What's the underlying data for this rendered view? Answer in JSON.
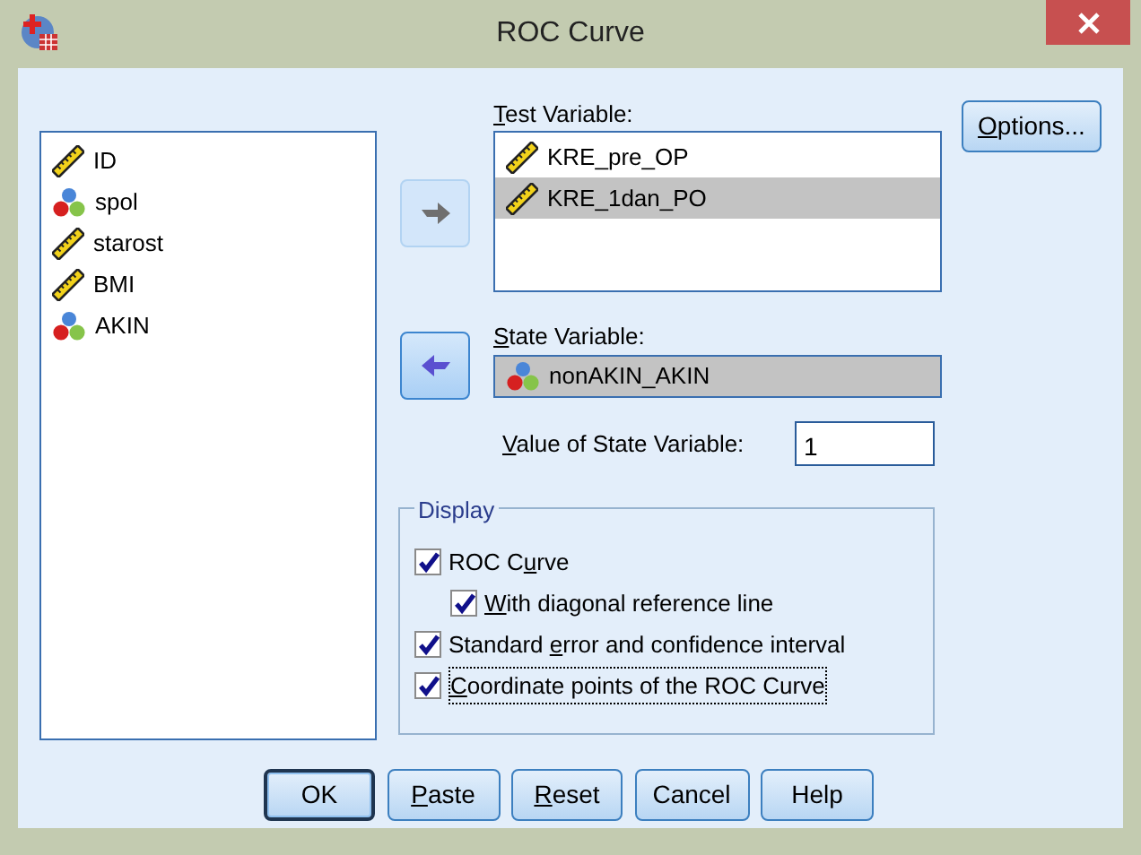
{
  "window": {
    "title": "ROC Curve"
  },
  "source_list": {
    "items": [
      {
        "kind": "scale",
        "label": "ID",
        "selected": false
      },
      {
        "kind": "nominal",
        "label": "spol",
        "selected": false
      },
      {
        "kind": "scale",
        "label": "starost",
        "selected": false
      },
      {
        "kind": "scale",
        "label": "BMI",
        "selected": false
      },
      {
        "kind": "nominal",
        "label": "AKIN",
        "selected": false
      }
    ]
  },
  "move_buttons": [
    {
      "kind": "right",
      "disabled": true
    },
    {
      "kind": "left",
      "disabled": false
    }
  ],
  "test_variable": {
    "label": {
      "key": "T",
      "post": "est Variable:"
    },
    "items": [
      {
        "kind": "scale",
        "label": "KRE_pre_OP",
        "selected": false
      },
      {
        "kind": "scale",
        "label": "KRE_1dan_PO",
        "selected": true
      }
    ]
  },
  "state_variable": {
    "label": {
      "key": "S",
      "post": "tate Variable:"
    },
    "items": [
      {
        "kind": "nominal",
        "label": "nonAKIN_AKIN",
        "selected": true
      }
    ]
  },
  "state_value": {
    "label": {
      "key": "V",
      "post": "alue of State Variable:"
    },
    "value": "1"
  },
  "options_button": {
    "label": {
      "key": "O",
      "post": "ptions..."
    }
  },
  "display": {
    "title": "Display",
    "options": [
      {
        "label": {
          "pre": "ROC C",
          "key": "u",
          "post": "rve"
        },
        "checked": true,
        "focused": false,
        "children": [
          {
            "label": {
              "key": "W",
              "post": "ith diagonal reference line"
            },
            "checked": true,
            "focused": false
          }
        ]
      },
      {
        "label": {
          "pre": "Standard ",
          "key": "e",
          "post": "rror and confidence interval"
        },
        "checked": true,
        "focused": false
      },
      {
        "label": {
          "key": "C",
          "post": "oordinate points of the ROC Curve"
        },
        "checked": true,
        "focused": true
      }
    ]
  },
  "buttons": [
    {
      "label": {
        "pre": "OK"
      },
      "default": true
    },
    {
      "label": {
        "key": "P",
        "post": "aste"
      },
      "default": false
    },
    {
      "label": {
        "key": "R",
        "post": "eset"
      },
      "default": false
    },
    {
      "label": {
        "pre": "Cancel"
      },
      "default": false
    },
    {
      "label": {
        "pre": "Help"
      },
      "default": false
    }
  ]
}
